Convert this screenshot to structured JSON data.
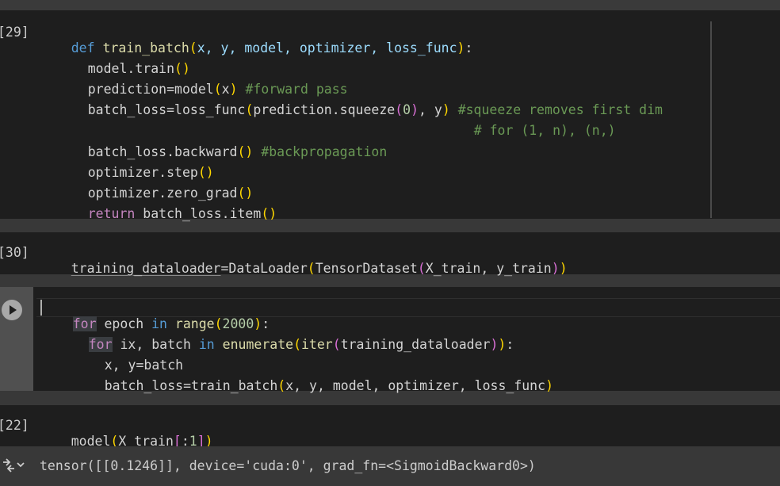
{
  "cells": [
    {
      "exec_label": "[29]",
      "tokens": [
        "def",
        "train_batch",
        "(",
        "x, y, model, optimizer, loss_func",
        ")",
        ":",
        "model.train",
        "()",
        "prediction=model",
        "(",
        "x",
        ")",
        "#forward pass",
        "batch_loss=loss_func",
        "(",
        "prediction.squeeze",
        "(",
        "0",
        ")",
        ", y",
        ")",
        "#squeeze removes first dim",
        "# for (1, n), (n,)",
        "batch_loss.backward",
        "()",
        "#backpropagation",
        "optimizer.step",
        "()",
        "optimizer.zero_grad",
        "()",
        "return",
        "batch_loss.item",
        "()"
      ]
    },
    {
      "exec_label": "[30]",
      "tokens": [
        "training_dataloader",
        "=DataLoader",
        "(",
        "TensorDataset",
        "(",
        "X_train, y_train",
        ")",
        ")"
      ]
    },
    {
      "exec_label": "",
      "tokens": [
        "for",
        " epoch ",
        "in",
        " range",
        "(",
        "2000",
        ")",
        ":",
        "for",
        " ix, batch ",
        "in",
        " enumerate",
        "(",
        "iter",
        "(",
        "training_dataloader",
        ")",
        ")",
        ":",
        "x, y=batch",
        "batch_loss=train_batch",
        "(",
        "x, y, model, optimizer, loss_func",
        ")"
      ]
    },
    {
      "exec_label": "[22]",
      "tokens": [
        "model",
        "(",
        "X_train",
        "[",
        ":",
        "1",
        "]",
        ")"
      ]
    }
  ],
  "output": {
    "text": "tensor([[0.1246]], device='cuda:0', grad_fn=<SigmoidBackward0>)"
  },
  "icons": {
    "run": "play-circle-icon",
    "output": "output-toggle-icon"
  },
  "colors": {
    "keyword": "#569cd6",
    "control": "#c586c0",
    "function": "#dcdcaa",
    "comment": "#6a9955",
    "bracket_1": "#ffd700",
    "bracket_2": "#da70d6",
    "bracket_3": "#179fff"
  }
}
